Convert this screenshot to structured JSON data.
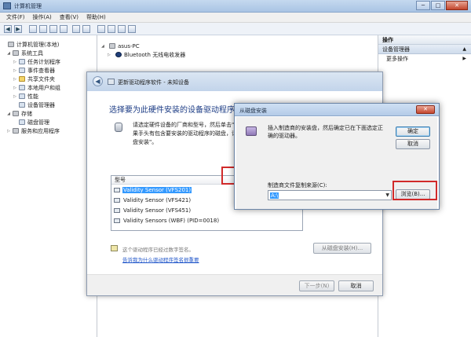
{
  "window": {
    "title": "计算机管理",
    "controls": {
      "minimize": "─",
      "maximize": "□",
      "close": "✕"
    }
  },
  "menu": [
    "文件(F)",
    "操作(A)",
    "查看(V)",
    "帮助(H)"
  ],
  "toolbar": {
    "back": "◀",
    "forward": "▶"
  },
  "tree": {
    "items": [
      {
        "label": "计算机管理(本地)",
        "twist": "",
        "icon": "computer-icon"
      },
      {
        "label": "系统工具",
        "twist": "◢",
        "icon": "tools-icon"
      },
      {
        "label": "任务计划程序",
        "twist": "▷",
        "icon": "task-scheduler-icon"
      },
      {
        "label": "事件查看器",
        "twist": "▷",
        "icon": "event-viewer-icon"
      },
      {
        "label": "共享文件夹",
        "twist": "▷",
        "icon": "shared-folder-icon"
      },
      {
        "label": "本地用户和组",
        "twist": "▷",
        "icon": "users-icon"
      },
      {
        "label": "性能",
        "twist": "▷",
        "icon": "performance-icon"
      },
      {
        "label": "设备管理器",
        "twist": "",
        "icon": "device-manager-icon"
      },
      {
        "label": "存储",
        "twist": "◢",
        "icon": "storage-icon"
      },
      {
        "label": "磁盘管理",
        "twist": "",
        "icon": "disk-management-icon"
      },
      {
        "label": "服务和应用程序",
        "twist": "▷",
        "icon": "services-icon"
      }
    ]
  },
  "device_list": {
    "computer": "asus-PC",
    "item1": "Bluetooth 无线电收发器"
  },
  "actions": {
    "header": "操作",
    "section": "设备管理器",
    "more": "更多操作",
    "chevron": "▲",
    "more_chevron": "▶"
  },
  "wizard": {
    "back": "◀",
    "title": "更新驱动程序软件 - 未知设备",
    "heading": "选择要为此硬件安装的设备驱动程序",
    "description": "请选定硬件设备的厂商和型号，然后单击\"下一步\"。如果手头有包含要安装的驱动程序的磁盘，请单击\"从磁盘安装\"。",
    "model_header": "型号",
    "models": [
      "Validity Sensor (VFS201)",
      "Validity Sensor (VFS421)",
      "Validity Sensor (VFS451)",
      "Validity Sensors (WBF) (PID=0018)"
    ],
    "selected_index": 0,
    "signature_text": "这个驱动程序已经过数字签名。",
    "signature_link": "告诉我为什么驱动程序签名很重要",
    "have_disk": "从磁盘安装(H)...",
    "next": "下一步(N)",
    "cancel": "取消"
  },
  "disk_dialog": {
    "title": "从磁盘安装",
    "close": "✕",
    "message": "插入制造商的安装盘，然后确定已在下面选定正确的驱动器。",
    "ok": "确定",
    "cancel": "取消",
    "copy_label": "制造商文件复制来源(C):",
    "copy_value": "A:\\",
    "dropdown": "▼",
    "browse": "浏览(B)..."
  },
  "colors": {
    "highlight_box": "#d12a2a",
    "selection": "#3399ff",
    "link": "#1f55c9"
  }
}
